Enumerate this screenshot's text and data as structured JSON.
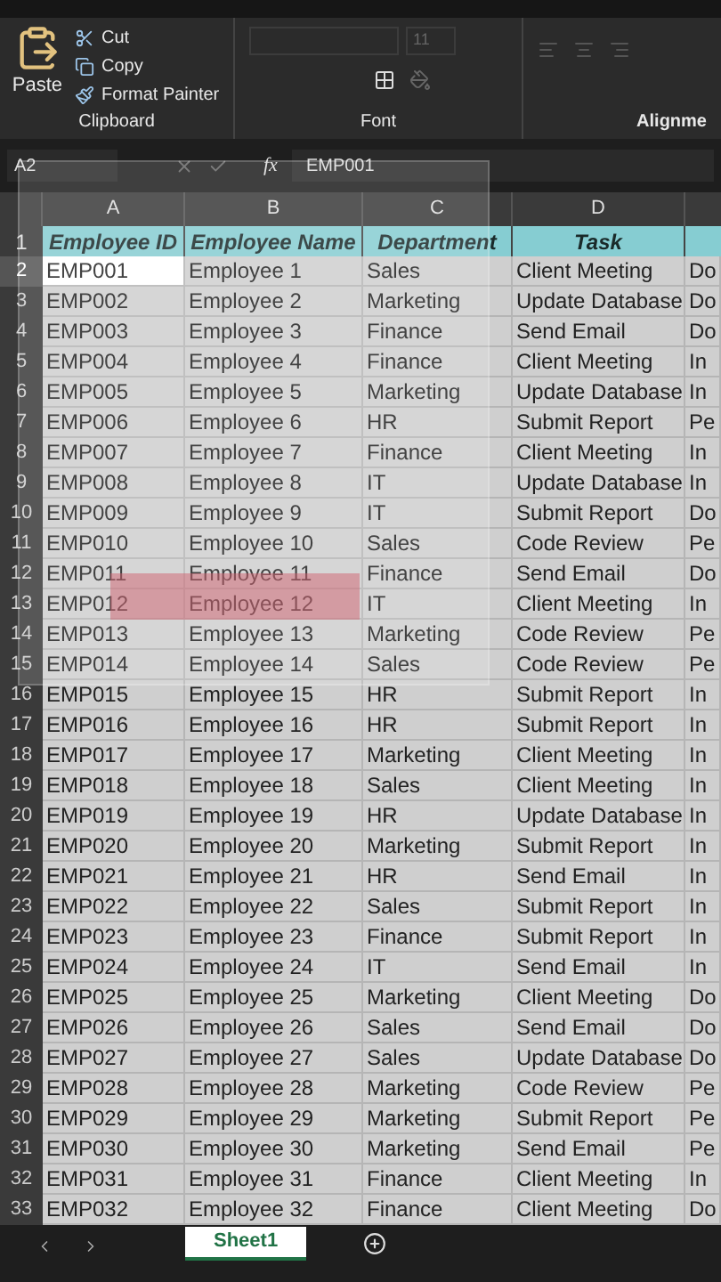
{
  "ribbon": {
    "clipboard": {
      "paste": "Paste",
      "commands": [
        {
          "kind": "cut",
          "label": "Cut"
        },
        {
          "kind": "copy",
          "label": "Copy"
        },
        {
          "kind": "painter",
          "label": "Format Painter"
        }
      ],
      "label": "Clipboard"
    },
    "font": {
      "size": "11",
      "label": "Font"
    },
    "alignment": {
      "label": "Alignme"
    }
  },
  "formula_bar": {
    "name_box": "A2",
    "fx": "fx",
    "value": "EMP001"
  },
  "sheet": {
    "columns": [
      "A",
      "B",
      "C",
      "D"
    ],
    "header": {
      "number": "1",
      "cells": [
        "Employee ID",
        "Employee Name",
        "Department",
        "Task"
      ]
    },
    "rows": [
      {
        "number": "2",
        "selected": true,
        "cells": [
          "EMP001",
          "Employee 1",
          "Sales",
          "Client Meeting",
          "Do"
        ]
      },
      {
        "number": "3",
        "selected": false,
        "cells": [
          "EMP002",
          "Employee 2",
          "Marketing",
          "Update Database",
          "Do"
        ]
      },
      {
        "number": "4",
        "selected": false,
        "cells": [
          "EMP003",
          "Employee 3",
          "Finance",
          "Send Email",
          "Do"
        ]
      },
      {
        "number": "5",
        "selected": false,
        "cells": [
          "EMP004",
          "Employee 4",
          "Finance",
          "Client Meeting",
          "In"
        ]
      },
      {
        "number": "6",
        "selected": false,
        "cells": [
          "EMP005",
          "Employee 5",
          "Marketing",
          "Update Database",
          "In"
        ]
      },
      {
        "number": "7",
        "selected": false,
        "cells": [
          "EMP006",
          "Employee 6",
          "HR",
          "Submit Report",
          "Pe"
        ]
      },
      {
        "number": "8",
        "selected": false,
        "cells": [
          "EMP007",
          "Employee 7",
          "Finance",
          "Client Meeting",
          "In"
        ]
      },
      {
        "number": "9",
        "selected": false,
        "cells": [
          "EMP008",
          "Employee 8",
          "IT",
          "Update Database",
          "In"
        ]
      },
      {
        "number": "10",
        "selected": false,
        "cells": [
          "EMP009",
          "Employee 9",
          "IT",
          "Submit Report",
          "Do"
        ]
      },
      {
        "number": "11",
        "selected": false,
        "cells": [
          "EMP010",
          "Employee 10",
          "Sales",
          "Code Review",
          "Pe"
        ]
      },
      {
        "number": "12",
        "selected": false,
        "cells": [
          "EMP011",
          "Employee 11",
          "Finance",
          "Send Email",
          "Do"
        ]
      },
      {
        "number": "13",
        "selected": false,
        "cells": [
          "EMP012",
          "Employee 12",
          "IT",
          "Client Meeting",
          "In"
        ]
      },
      {
        "number": "14",
        "selected": false,
        "cells": [
          "EMP013",
          "Employee 13",
          "Marketing",
          "Code Review",
          "Pe"
        ]
      },
      {
        "number": "15",
        "selected": false,
        "cells": [
          "EMP014",
          "Employee 14",
          "Sales",
          "Code Review",
          "Pe"
        ]
      },
      {
        "number": "16",
        "selected": false,
        "cells": [
          "EMP015",
          "Employee 15",
          "HR",
          "Submit Report",
          "In"
        ]
      },
      {
        "number": "17",
        "selected": false,
        "cells": [
          "EMP016",
          "Employee 16",
          "HR",
          "Submit Report",
          "In"
        ]
      },
      {
        "number": "18",
        "selected": false,
        "cells": [
          "EMP017",
          "Employee 17",
          "Marketing",
          "Client Meeting",
          "In"
        ]
      },
      {
        "number": "19",
        "selected": false,
        "cells": [
          "EMP018",
          "Employee 18",
          "Sales",
          "Client Meeting",
          "In"
        ]
      },
      {
        "number": "20",
        "selected": false,
        "cells": [
          "EMP019",
          "Employee 19",
          "HR",
          "Update Database",
          "In"
        ]
      },
      {
        "number": "21",
        "selected": false,
        "cells": [
          "EMP020",
          "Employee 20",
          "Marketing",
          "Submit Report",
          "In"
        ]
      },
      {
        "number": "22",
        "selected": false,
        "cells": [
          "EMP021",
          "Employee 21",
          "HR",
          "Send Email",
          "In"
        ]
      },
      {
        "number": "23",
        "selected": false,
        "cells": [
          "EMP022",
          "Employee 22",
          "Sales",
          "Submit Report",
          "In"
        ]
      },
      {
        "number": "24",
        "selected": false,
        "cells": [
          "EMP023",
          "Employee 23",
          "Finance",
          "Submit Report",
          "In"
        ]
      },
      {
        "number": "25",
        "selected": false,
        "cells": [
          "EMP024",
          "Employee 24",
          "IT",
          "Send Email",
          "In"
        ]
      },
      {
        "number": "26",
        "selected": false,
        "cells": [
          "EMP025",
          "Employee 25",
          "Marketing",
          "Client Meeting",
          "Do"
        ]
      },
      {
        "number": "27",
        "selected": false,
        "cells": [
          "EMP026",
          "Employee 26",
          "Sales",
          "Send Email",
          "Do"
        ]
      },
      {
        "number": "28",
        "selected": false,
        "cells": [
          "EMP027",
          "Employee 27",
          "Sales",
          "Update Database",
          "Do"
        ]
      },
      {
        "number": "29",
        "selected": false,
        "cells": [
          "EMP028",
          "Employee 28",
          "Marketing",
          "Code Review",
          "Pe"
        ]
      },
      {
        "number": "30",
        "selected": false,
        "cells": [
          "EMP029",
          "Employee 29",
          "Marketing",
          "Submit Report",
          "Pe"
        ]
      },
      {
        "number": "31",
        "selected": false,
        "cells": [
          "EMP030",
          "Employee 30",
          "Marketing",
          "Send Email",
          "Pe"
        ]
      },
      {
        "number": "32",
        "selected": false,
        "cells": [
          "EMP031",
          "Employee 31",
          "Finance",
          "Client Meeting",
          "In"
        ]
      },
      {
        "number": "33",
        "selected": false,
        "cells": [
          "EMP032",
          "Employee 32",
          "Finance",
          "Client Meeting",
          "Do"
        ]
      }
    ]
  },
  "tabs": [
    {
      "label": "Sheet1",
      "selected": true
    }
  ]
}
